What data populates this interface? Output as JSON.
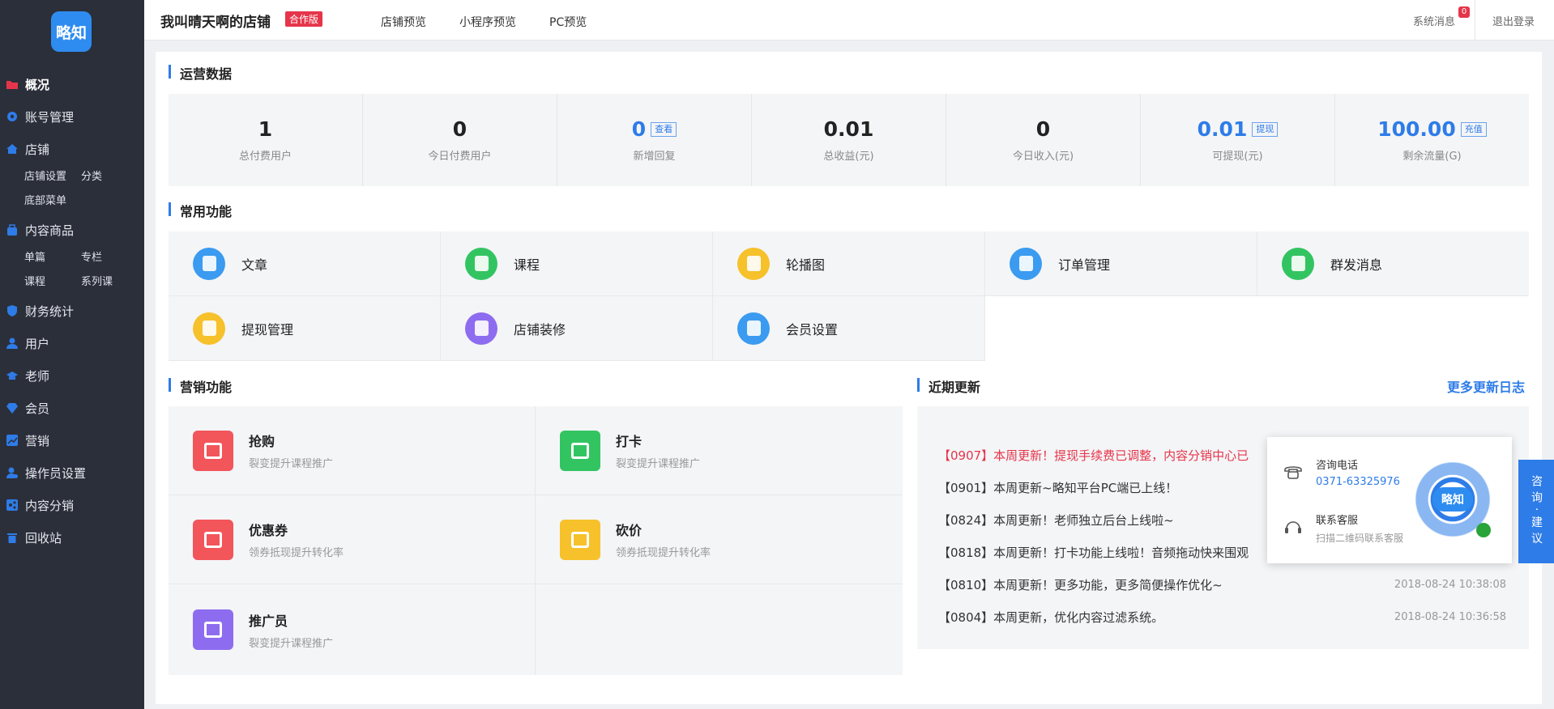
{
  "sidebar": {
    "logo": "略知",
    "overview": "概况",
    "account": "账号管理",
    "shop": "店铺",
    "shop_sub": [
      "店铺设置",
      "分类",
      "底部菜单"
    ],
    "content": "内容商品",
    "content_sub": [
      "单篇",
      "专栏",
      "课程",
      "系列课"
    ],
    "finance": "财务统计",
    "users": "用户",
    "teacher": "老师",
    "member": "会员",
    "marketing": "营销",
    "operator": "操作员设置",
    "distribution": "内容分销",
    "recycle": "回收站"
  },
  "topbar": {
    "shop_name": "我叫晴天啊的店铺",
    "coop_tag": "合作版",
    "nav": [
      "店铺预览",
      "小程序预览",
      "PC预览"
    ],
    "sys_msg": "系统消息",
    "msg_count": "0",
    "logout": "退出登录"
  },
  "ops": {
    "title": "运营数据",
    "stats": [
      {
        "value": "1",
        "label": "总付费用户",
        "tag": ""
      },
      {
        "value": "0",
        "label": "今日付费用户",
        "tag": ""
      },
      {
        "value": "0",
        "label": "新增回复",
        "tag": "查看"
      },
      {
        "value": "0.01",
        "label": "总收益(元)",
        "tag": ""
      },
      {
        "value": "0",
        "label": "今日收入(元)",
        "tag": ""
      },
      {
        "value": "0.01",
        "label": "可提现(元)",
        "tag": "提现"
      },
      {
        "value": "100.00",
        "label": "剩余流量(G)",
        "tag": "充值"
      }
    ]
  },
  "func": {
    "title": "常用功能",
    "items": [
      "文章",
      "课程",
      "轮播图",
      "订单管理",
      "群发消息",
      "提现管理",
      "店铺装修",
      "会员设置"
    ]
  },
  "mkt": {
    "title": "营销功能",
    "items": [
      {
        "title": "抢购",
        "desc": "裂变提升课程推广"
      },
      {
        "title": "打卡",
        "desc": "裂变提升课程推广"
      },
      {
        "title": "优惠券",
        "desc": "领券抵现提升转化率"
      },
      {
        "title": "砍价",
        "desc": "领券抵现提升转化率"
      },
      {
        "title": "推广员",
        "desc": "裂变提升课程推广"
      }
    ]
  },
  "updates": {
    "title": "近期更新",
    "more": "更多更新日志",
    "items": [
      {
        "text": "【0907】本周更新！提现手续费已调整，内容分销中心已",
        "date": ""
      },
      {
        "text": "【0901】本周更新~略知平台PC端已上线！",
        "date": ""
      },
      {
        "text": "【0824】本周更新！老师独立后台上线啦~",
        "date": ""
      },
      {
        "text": "【0818】本周更新！打卡功能上线啦！音频拖动快来围观",
        "date": ""
      },
      {
        "text": "【0810】本周更新！更多功能，更多简便操作优化~",
        "date": "2018-08-24 10:38:08"
      },
      {
        "text": "【0804】本周更新，优化内容过滤系统。",
        "date": "2018-08-24 10:36:58"
      }
    ]
  },
  "contact": {
    "phone_label": "咨询电话",
    "phone": "0371-63325976",
    "service_label": "联系客服",
    "service_desc": "扫描二维码联系客服",
    "qr_logo": "略知",
    "tab": "咨询·建议"
  },
  "colors": {
    "sidebar": "#2b2f3a",
    "accent": "#2e7ce8",
    "red": "#e6354a"
  }
}
